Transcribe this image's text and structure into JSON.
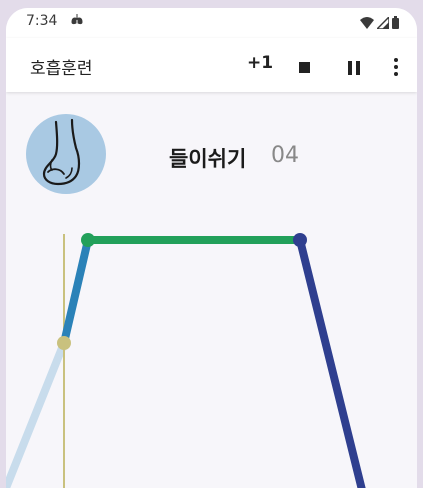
{
  "status": {
    "time": "7:34",
    "lung_icon": "lungs-icon",
    "wifi_icon": "wifi-icon",
    "signal_icon": "signal-icon",
    "battery_icon": "battery-icon"
  },
  "toolbar": {
    "title": "호흡훈련",
    "plus_one": "+1",
    "stop_icon": "stop-icon",
    "pause_icon": "pause-icon",
    "more_icon": "more-vert-icon"
  },
  "phase": {
    "label": "들이쉬기",
    "count": "04",
    "avatar_icon": "nose-icon"
  },
  "colors": {
    "inhale": "#2b82b8",
    "hold": "#22a05a",
    "exhale": "#2f3f8f",
    "past": "#c8dcec",
    "cursor": "#c9c17e"
  }
}
